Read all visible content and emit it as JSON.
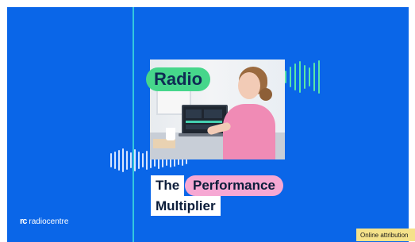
{
  "slide": {
    "headline_tag": "Radio",
    "title_word_1": "The",
    "title_word_2": "Performance",
    "title_word_3": "Multiplier",
    "brand_mark": "rc",
    "brand_name": "radiocentre"
  },
  "badge": {
    "label": "Online attribution"
  },
  "colors": {
    "background": "#0a66e8",
    "accent_green": "#46d68b",
    "accent_pink": "#f6a8d3",
    "accent_cyan_line": "#37d3dc",
    "badge_yellow": "#f5e28a"
  },
  "icons": [
    "radiocentre-logo-icon",
    "soundwave-icon"
  ]
}
